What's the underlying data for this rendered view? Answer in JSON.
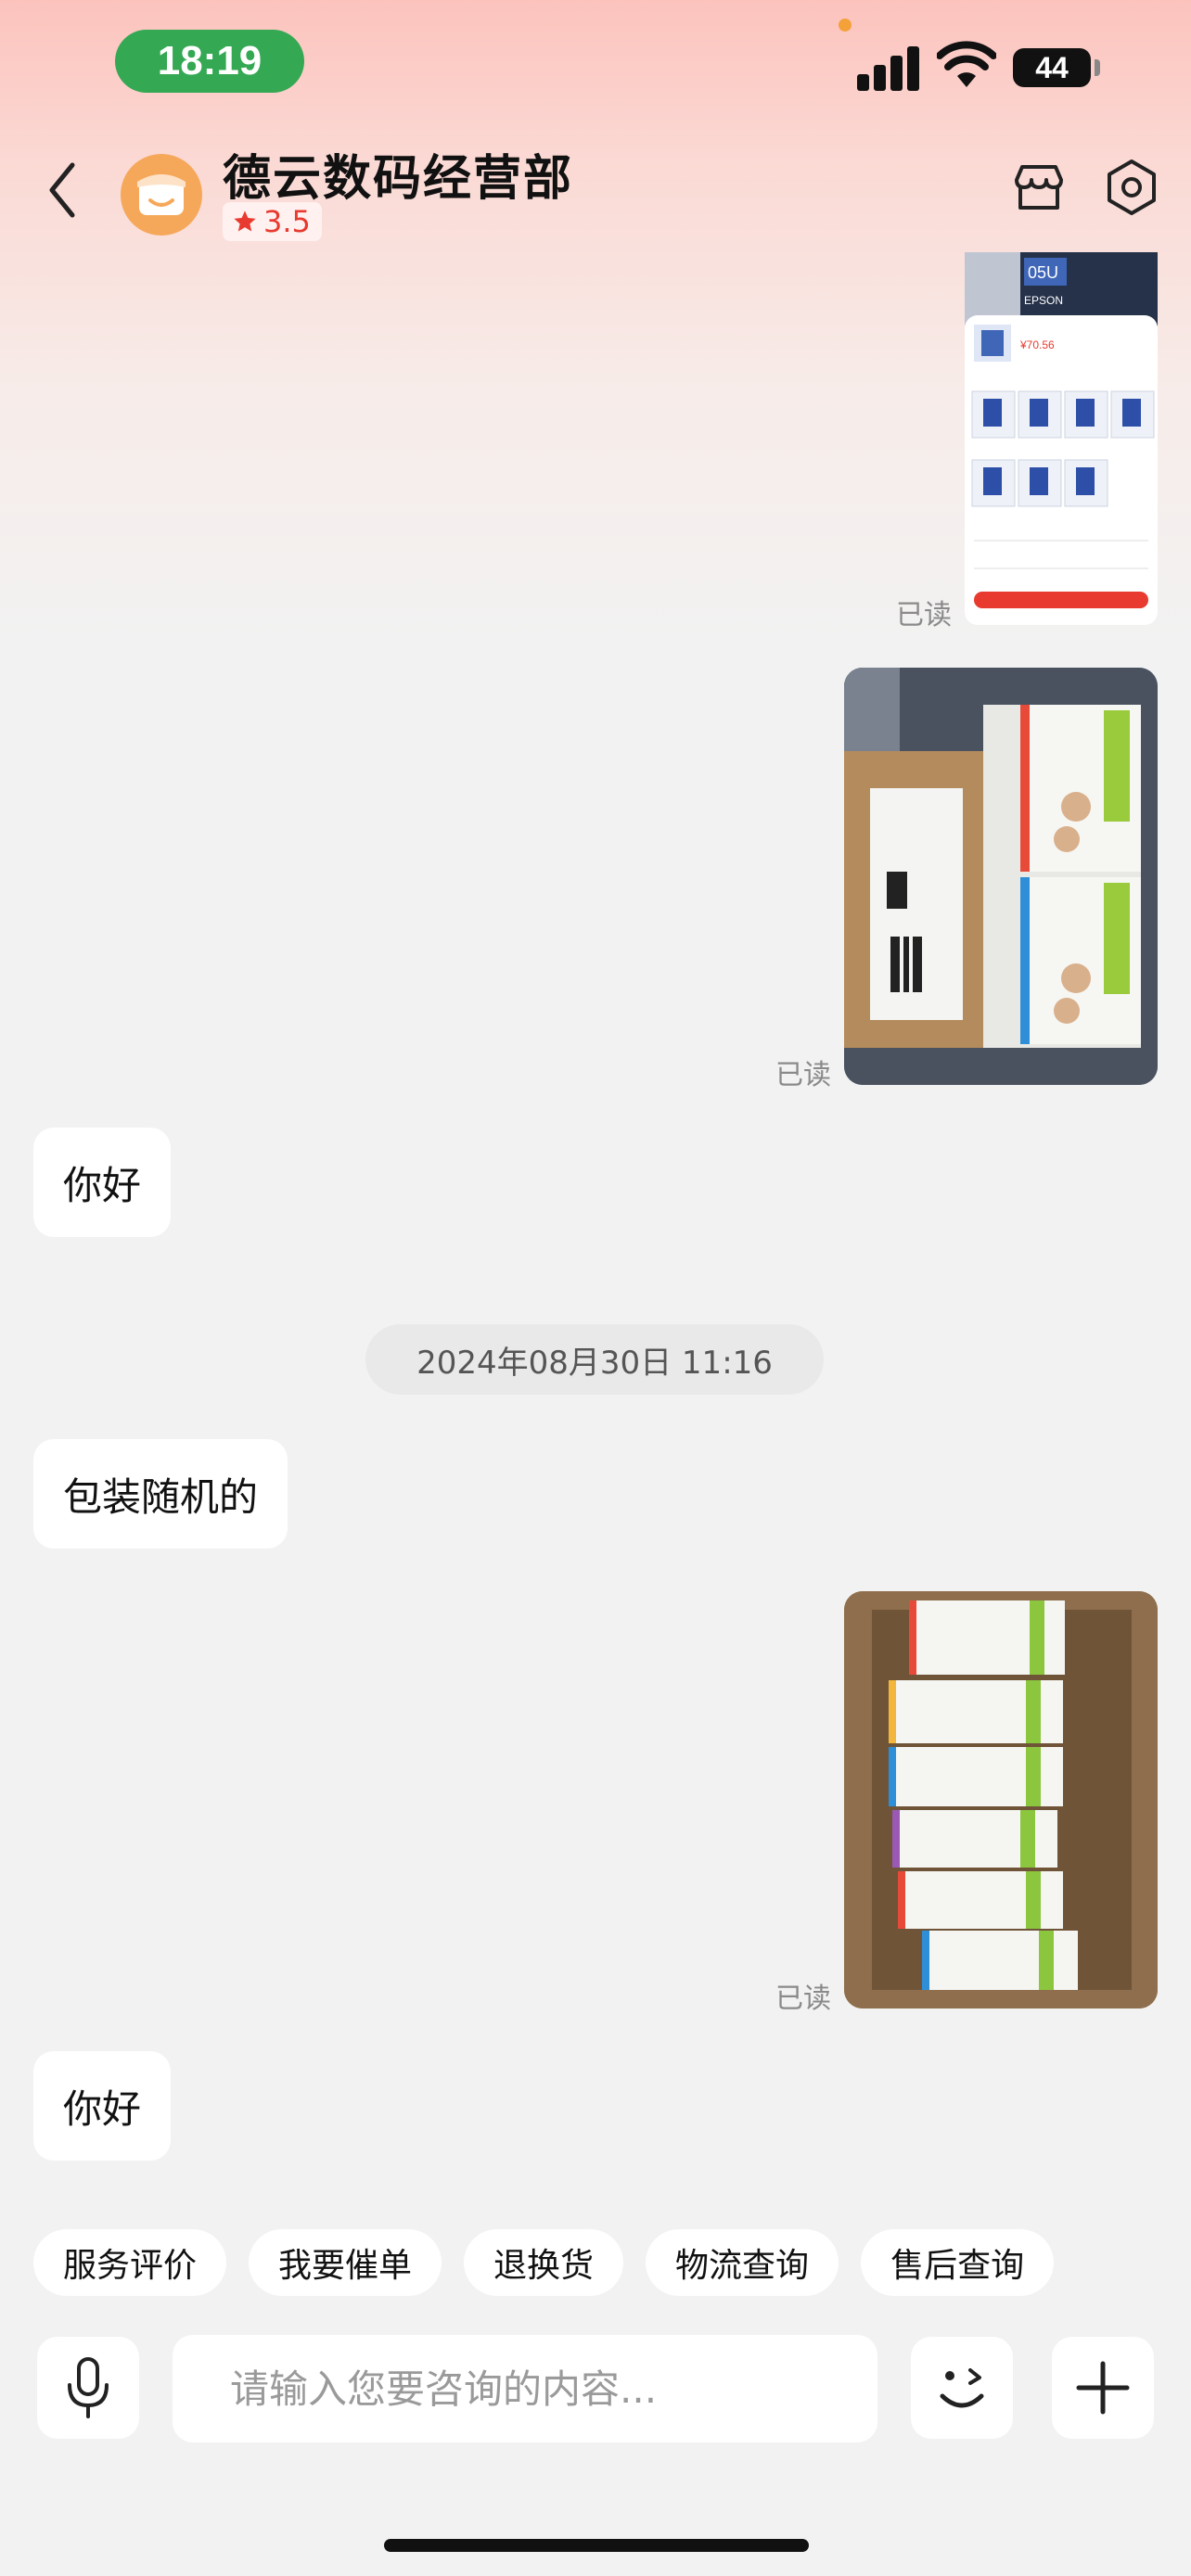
{
  "status_bar": {
    "time": "18:19",
    "battery": "44",
    "icons": [
      "cellular-signal-icon",
      "wifi-icon",
      "battery-icon"
    ]
  },
  "header": {
    "title": "德云数码经营部",
    "rating": "3.5",
    "icons": [
      "back-icon",
      "store-avatar-icon",
      "star-icon",
      "store-icon",
      "settings-icon"
    ]
  },
  "messages": [
    {
      "type": "image",
      "side": "right",
      "content": "Product page screenshot",
      "status": "已读"
    },
    {
      "type": "image",
      "side": "right",
      "content": "Photo of ink boxes",
      "status": "已读"
    },
    {
      "type": "text",
      "side": "left",
      "text": "你好"
    },
    {
      "type": "timestamp",
      "text": "2024年08月30日 11:16"
    },
    {
      "type": "text",
      "side": "left",
      "text": "包装随机的"
    },
    {
      "type": "image",
      "side": "right",
      "content": "Photo of ink bottles in carton",
      "status": "已读"
    },
    {
      "type": "text",
      "side": "left",
      "text": "你好"
    }
  ],
  "screenshot_thumb": {
    "model_text": "05U",
    "brand_text": "EPSON",
    "price": "¥70.56"
  },
  "quick_actions": [
    "服务评价",
    "我要催单",
    "退换货",
    "物流查询",
    "售后查询"
  ],
  "input": {
    "placeholder": "请输入您要咨询的内容..."
  },
  "colors": {
    "accent_red": "#e83a2e",
    "time_pill_green": "#34a853",
    "avatar_orange": "#f6a85a"
  }
}
